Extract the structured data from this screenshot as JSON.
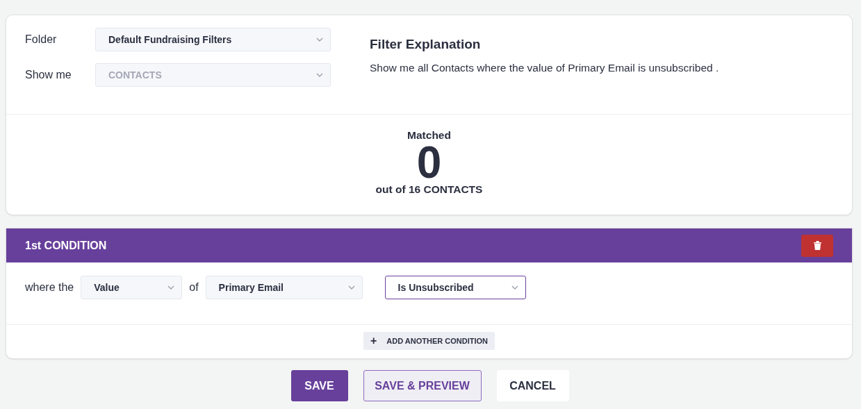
{
  "filter": {
    "fields": [
      {
        "label": "Folder",
        "value": "Default Fundraising Filters",
        "disabled": false
      },
      {
        "label": "Show me",
        "value": "CONTACTS",
        "disabled": true
      }
    ],
    "explanation_title": "Filter Explanation",
    "explanation": "Show me all Contacts where the value of Primary Email is unsubscribed ."
  },
  "match": {
    "label": "Matched",
    "count": "0",
    "total": "out of 16 CONTACTS"
  },
  "conditions": [
    {
      "title": "1st CONDITION",
      "lead": "where the",
      "joiner": "of",
      "selects": [
        {
          "value": "Value",
          "focused": false
        },
        {
          "value": "Primary Email",
          "focused": false
        },
        {
          "value": "Is Unsubscribed",
          "focused": true
        }
      ]
    }
  ],
  "add_condition": {
    "icon": "+",
    "label": "ADD ANOTHER CONDITION"
  },
  "buttons": [
    {
      "label": "SAVE",
      "kind": "primary"
    },
    {
      "label": "SAVE & PREVIEW",
      "kind": "secondary"
    },
    {
      "label": "CANCEL",
      "kind": "plain"
    }
  ]
}
